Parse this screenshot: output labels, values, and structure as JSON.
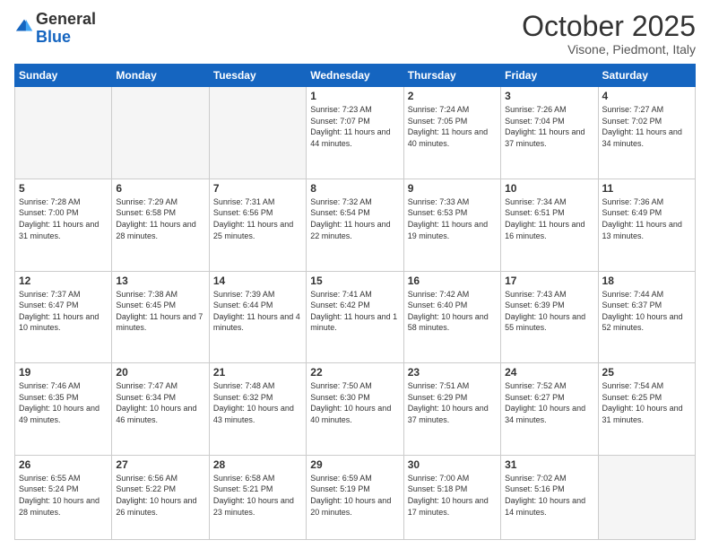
{
  "header": {
    "logo_general": "General",
    "logo_blue": "Blue",
    "month_title": "October 2025",
    "location": "Visone, Piedmont, Italy"
  },
  "days_of_week": [
    "Sunday",
    "Monday",
    "Tuesday",
    "Wednesday",
    "Thursday",
    "Friday",
    "Saturday"
  ],
  "weeks": [
    [
      {
        "day": "",
        "info": ""
      },
      {
        "day": "",
        "info": ""
      },
      {
        "day": "",
        "info": ""
      },
      {
        "day": "1",
        "info": "Sunrise: 7:23 AM\nSunset: 7:07 PM\nDaylight: 11 hours and 44 minutes."
      },
      {
        "day": "2",
        "info": "Sunrise: 7:24 AM\nSunset: 7:05 PM\nDaylight: 11 hours and 40 minutes."
      },
      {
        "day": "3",
        "info": "Sunrise: 7:26 AM\nSunset: 7:04 PM\nDaylight: 11 hours and 37 minutes."
      },
      {
        "day": "4",
        "info": "Sunrise: 7:27 AM\nSunset: 7:02 PM\nDaylight: 11 hours and 34 minutes."
      }
    ],
    [
      {
        "day": "5",
        "info": "Sunrise: 7:28 AM\nSunset: 7:00 PM\nDaylight: 11 hours and 31 minutes."
      },
      {
        "day": "6",
        "info": "Sunrise: 7:29 AM\nSunset: 6:58 PM\nDaylight: 11 hours and 28 minutes."
      },
      {
        "day": "7",
        "info": "Sunrise: 7:31 AM\nSunset: 6:56 PM\nDaylight: 11 hours and 25 minutes."
      },
      {
        "day": "8",
        "info": "Sunrise: 7:32 AM\nSunset: 6:54 PM\nDaylight: 11 hours and 22 minutes."
      },
      {
        "day": "9",
        "info": "Sunrise: 7:33 AM\nSunset: 6:53 PM\nDaylight: 11 hours and 19 minutes."
      },
      {
        "day": "10",
        "info": "Sunrise: 7:34 AM\nSunset: 6:51 PM\nDaylight: 11 hours and 16 minutes."
      },
      {
        "day": "11",
        "info": "Sunrise: 7:36 AM\nSunset: 6:49 PM\nDaylight: 11 hours and 13 minutes."
      }
    ],
    [
      {
        "day": "12",
        "info": "Sunrise: 7:37 AM\nSunset: 6:47 PM\nDaylight: 11 hours and 10 minutes."
      },
      {
        "day": "13",
        "info": "Sunrise: 7:38 AM\nSunset: 6:45 PM\nDaylight: 11 hours and 7 minutes."
      },
      {
        "day": "14",
        "info": "Sunrise: 7:39 AM\nSunset: 6:44 PM\nDaylight: 11 hours and 4 minutes."
      },
      {
        "day": "15",
        "info": "Sunrise: 7:41 AM\nSunset: 6:42 PM\nDaylight: 11 hours and 1 minute."
      },
      {
        "day": "16",
        "info": "Sunrise: 7:42 AM\nSunset: 6:40 PM\nDaylight: 10 hours and 58 minutes."
      },
      {
        "day": "17",
        "info": "Sunrise: 7:43 AM\nSunset: 6:39 PM\nDaylight: 10 hours and 55 minutes."
      },
      {
        "day": "18",
        "info": "Sunrise: 7:44 AM\nSunset: 6:37 PM\nDaylight: 10 hours and 52 minutes."
      }
    ],
    [
      {
        "day": "19",
        "info": "Sunrise: 7:46 AM\nSunset: 6:35 PM\nDaylight: 10 hours and 49 minutes."
      },
      {
        "day": "20",
        "info": "Sunrise: 7:47 AM\nSunset: 6:34 PM\nDaylight: 10 hours and 46 minutes."
      },
      {
        "day": "21",
        "info": "Sunrise: 7:48 AM\nSunset: 6:32 PM\nDaylight: 10 hours and 43 minutes."
      },
      {
        "day": "22",
        "info": "Sunrise: 7:50 AM\nSunset: 6:30 PM\nDaylight: 10 hours and 40 minutes."
      },
      {
        "day": "23",
        "info": "Sunrise: 7:51 AM\nSunset: 6:29 PM\nDaylight: 10 hours and 37 minutes."
      },
      {
        "day": "24",
        "info": "Sunrise: 7:52 AM\nSunset: 6:27 PM\nDaylight: 10 hours and 34 minutes."
      },
      {
        "day": "25",
        "info": "Sunrise: 7:54 AM\nSunset: 6:25 PM\nDaylight: 10 hours and 31 minutes."
      }
    ],
    [
      {
        "day": "26",
        "info": "Sunrise: 6:55 AM\nSunset: 5:24 PM\nDaylight: 10 hours and 28 minutes."
      },
      {
        "day": "27",
        "info": "Sunrise: 6:56 AM\nSunset: 5:22 PM\nDaylight: 10 hours and 26 minutes."
      },
      {
        "day": "28",
        "info": "Sunrise: 6:58 AM\nSunset: 5:21 PM\nDaylight: 10 hours and 23 minutes."
      },
      {
        "day": "29",
        "info": "Sunrise: 6:59 AM\nSunset: 5:19 PM\nDaylight: 10 hours and 20 minutes."
      },
      {
        "day": "30",
        "info": "Sunrise: 7:00 AM\nSunset: 5:18 PM\nDaylight: 10 hours and 17 minutes."
      },
      {
        "day": "31",
        "info": "Sunrise: 7:02 AM\nSunset: 5:16 PM\nDaylight: 10 hours and 14 minutes."
      },
      {
        "day": "",
        "info": ""
      }
    ]
  ]
}
